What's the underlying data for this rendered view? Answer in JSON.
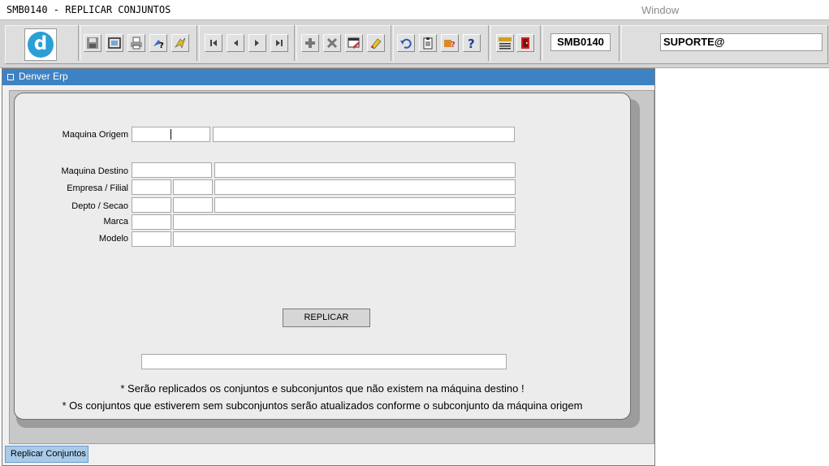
{
  "app": {
    "title": "SMB0140 - REPLICAR CONJUNTOS",
    "menu_window": "Window"
  },
  "toolbar": {
    "logo_letter": "d",
    "form_code": "SMB0140",
    "user": "SUPORTE@",
    "icons": [
      "save-icon",
      "print-preview-icon",
      "print-icon",
      "query-icon",
      "execute-query-icon",
      "first-record-icon",
      "previous-record-icon",
      "next-record-icon",
      "last-record-icon",
      "insert-record-icon",
      "delete-record-icon",
      "edit-record-icon",
      "clear-icon",
      "undo-icon",
      "clipboard-icon",
      "help-hand-icon",
      "help-icon",
      "menu-icon",
      "exit-icon"
    ]
  },
  "window": {
    "title": "Denver Erp"
  },
  "form": {
    "maquina_origem": {
      "label": "Maquina Origem",
      "code": "",
      "desc": ""
    },
    "maquina_destino": {
      "label": "Maquina Destino",
      "code": "",
      "desc": ""
    },
    "empresa_filial": {
      "label": "Empresa / Filial",
      "empresa": "",
      "filial": "",
      "desc": ""
    },
    "depto_secao": {
      "label": "Depto / Secao",
      "depto": "",
      "secao": "",
      "desc": ""
    },
    "marca": {
      "label": "Marca",
      "code": "",
      "desc": ""
    },
    "modelo": {
      "label": "Modelo",
      "code": "",
      "desc": ""
    },
    "replicar_label": "REPLICAR",
    "status": "",
    "note1": "* Serão replicados os conjuntos e subconjuntos que não existem na máquina destino !",
    "note2": "* Os conjuntos que estiverem sem subconjuntos serão atualizados conforme o subconjunto da máquina origem"
  },
  "tabs": [
    {
      "label": "Replicar Conjuntos",
      "active": true
    }
  ]
}
